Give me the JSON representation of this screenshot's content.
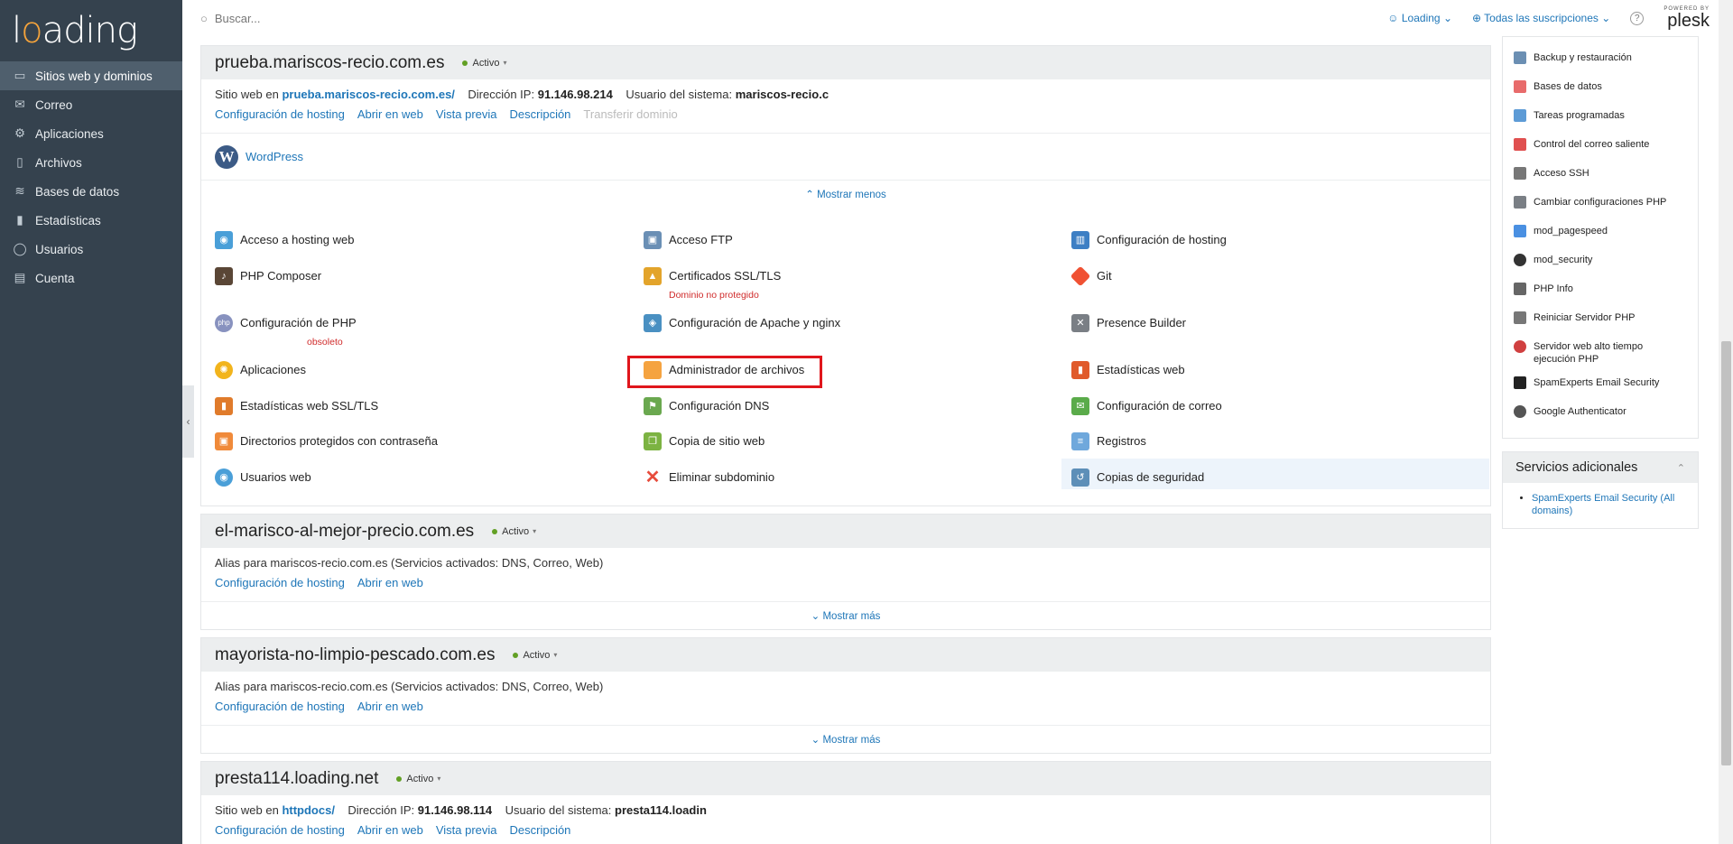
{
  "logo": {
    "text_pre": "l",
    "text_o": "o",
    "text_post": "ading"
  },
  "sidebar": {
    "items": [
      {
        "label": "Sitios web y dominios",
        "icon": "monitor-icon",
        "active": true
      },
      {
        "label": "Correo",
        "icon": "mail-icon"
      },
      {
        "label": "Aplicaciones",
        "icon": "gear-icon"
      },
      {
        "label": "Archivos",
        "icon": "folder-icon"
      },
      {
        "label": "Bases de datos",
        "icon": "layers-icon"
      },
      {
        "label": "Estadísticas",
        "icon": "bar-chart-icon"
      },
      {
        "label": "Usuarios",
        "icon": "user-icon"
      },
      {
        "label": "Cuenta",
        "icon": "briefcase-icon"
      }
    ]
  },
  "topbar": {
    "search_placeholder": "Buscar...",
    "user": "Loading",
    "subscriptions": "Todas las suscripciones",
    "help": "?",
    "powered": "POWERED BY",
    "brand": "plesk"
  },
  "domain1": {
    "name": "prueba.mariscos-recio.com.es",
    "status": "Activo",
    "info_site": "Sitio web en",
    "info_site_link": "prueba.mariscos-recio.com.es/",
    "info_ip_label": "Dirección IP:",
    "info_ip": "91.146.98.214",
    "info_user_label": "Usuario del sistema:",
    "info_user": "mariscos-recio.c",
    "links": [
      "Configuración de hosting",
      "Abrir en web",
      "Vista previa",
      "Descripción"
    ],
    "link_disabled": "Transferir dominio",
    "wordpress": "WordPress",
    "toggle": "Mostrar menos",
    "tools": [
      {
        "label": "Acceso a hosting web",
        "icon": "globe-user-icon",
        "color": "#4a9fd8"
      },
      {
        "label": "Acceso FTP",
        "icon": "ftp-icon",
        "color": "#6a8fb5"
      },
      {
        "label": "Configuración de hosting",
        "icon": "hosting-config-icon",
        "color": "#3d7fc4"
      },
      {
        "label": "PHP Composer",
        "icon": "composer-icon",
        "color": "#5a4636"
      },
      {
        "label": "Certificados SSL/TLS",
        "icon": "lock-icon",
        "color": "#e3a42b",
        "sub": "Dominio no protegido"
      },
      {
        "label": "Git",
        "icon": "git-icon",
        "color": "#f05133"
      },
      {
        "label": "Configuración de PHP",
        "icon": "php-icon",
        "color": "#8892bf",
        "sub": "obsoleto"
      },
      {
        "label": "Configuración de Apache y nginx",
        "icon": "apache-icon",
        "color": "#4a90c2"
      },
      {
        "label": "Presence Builder",
        "icon": "tools-icon",
        "color": "#7a7f85"
      },
      {
        "label": "Aplicaciones",
        "icon": "sun-gear-icon",
        "color": "#f2b41c"
      },
      {
        "label": "Administrador de archivos",
        "icon": "folder-icon",
        "color": "#f5a340"
      },
      {
        "label": "Estadísticas web",
        "icon": "bar-chart-icon",
        "color": "#e05a2b"
      },
      {
        "label": "Estadísticas web SSL/TLS",
        "icon": "chart-lock-icon",
        "color": "#e07b2b"
      },
      {
        "label": "Configuración DNS",
        "icon": "dns-flag-icon",
        "color": "#6aa84f"
      },
      {
        "label": "Configuración de correo",
        "icon": "mail-config-icon",
        "color": "#5aab4a"
      },
      {
        "label": "Directorios protegidos con contraseña",
        "icon": "folder-lock-icon",
        "color": "#f08a3a"
      },
      {
        "label": "Copia de sitio web",
        "icon": "copy-icon",
        "color": "#7cb342"
      },
      {
        "label": "Registros",
        "icon": "log-icon",
        "color": "#6fa8dc"
      },
      {
        "label": "Usuarios web",
        "icon": "web-users-icon",
        "color": "#4a9fd8"
      },
      {
        "label": "Eliminar subdominio",
        "icon": "delete-x-icon",
        "color": "#e74c3c"
      },
      {
        "label": "Copias de seguridad",
        "icon": "backup-icon",
        "color": "#5d8fb8"
      }
    ]
  },
  "domain2": {
    "name": "el-marisco-al-mejor-precio.com.es",
    "status": "Activo",
    "info": "Alias para mariscos-recio.com.es (Servicios activados: DNS, Correo, Web)",
    "links": [
      "Configuración de hosting",
      "Abrir en web"
    ],
    "toggle": "Mostrar más"
  },
  "domain3": {
    "name": "mayorista-no-limpio-pescado.com.es",
    "status": "Activo",
    "info": "Alias para mariscos-recio.com.es (Servicios activados: DNS, Correo, Web)",
    "links": [
      "Configuración de hosting",
      "Abrir en web"
    ],
    "toggle": "Mostrar más"
  },
  "domain4": {
    "name": "presta114.loading.net",
    "status": "Activo",
    "info_site": "Sitio web en",
    "info_site_link": "httpdocs/",
    "info_ip_label": "Dirección IP:",
    "info_ip": "91.146.98.114",
    "info_user_label": "Usuario del sistema:",
    "info_user": "presta114.loadin",
    "links": [
      "Configuración de hosting",
      "Abrir en web",
      "Vista previa",
      "Descripción"
    ]
  },
  "rightpanel": {
    "items": [
      {
        "label": "Backup y restauración",
        "icon": "backup-icon",
        "color": "#6b8fb3"
      },
      {
        "label": "Bases de datos",
        "icon": "database-icon",
        "color": "#e86b6b"
      },
      {
        "label": "Tareas programadas",
        "icon": "calendar-icon",
        "color": "#5d9bd6"
      },
      {
        "label": "Control del correo saliente",
        "icon": "mail-icon",
        "color": "#e05050"
      },
      {
        "label": "Acceso SSH",
        "icon": "terminal-icon",
        "color": "#777777"
      },
      {
        "label": "Cambiar configuraciones PHP",
        "icon": "php-settings-icon",
        "color": "#7a7f85"
      },
      {
        "label": "mod_pagespeed",
        "icon": "speed-icon",
        "color": "#4a90e2"
      },
      {
        "label": "mod_security",
        "icon": "shield-icon",
        "color": "#333333"
      },
      {
        "label": "PHP Info",
        "icon": "info-icon",
        "color": "#666666"
      },
      {
        "label": "Reiniciar Servidor PHP",
        "icon": "restart-icon",
        "color": "#777777"
      },
      {
        "label": "Servidor web alto tiempo ejecución PHP",
        "icon": "clock-icon",
        "color": "#d04040"
      },
      {
        "label": "SpamExperts Email Security",
        "icon": "spam-icon",
        "color": "#222222"
      },
      {
        "label": "Google Authenticator",
        "icon": "authenticator-icon",
        "color": "#555555"
      }
    ],
    "extra_title": "Servicios adicionales",
    "extra_items": [
      "SpamExperts Email Security (All domains)"
    ]
  }
}
